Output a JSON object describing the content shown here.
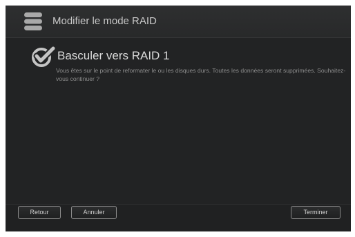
{
  "dialog": {
    "title": "Modifier le mode RAID",
    "header_icon": "database-icon"
  },
  "content": {
    "icon": "checkmark-icon",
    "heading": "Basculer vers RAID 1",
    "message": "Vous êtes sur le point de reformater le ou les disques durs. Toutes les données seront supprimées. Souhaitez-vous continuer ?"
  },
  "footer": {
    "back_label": "Retour",
    "cancel_label": "Annuler",
    "finish_label": "Terminer"
  }
}
